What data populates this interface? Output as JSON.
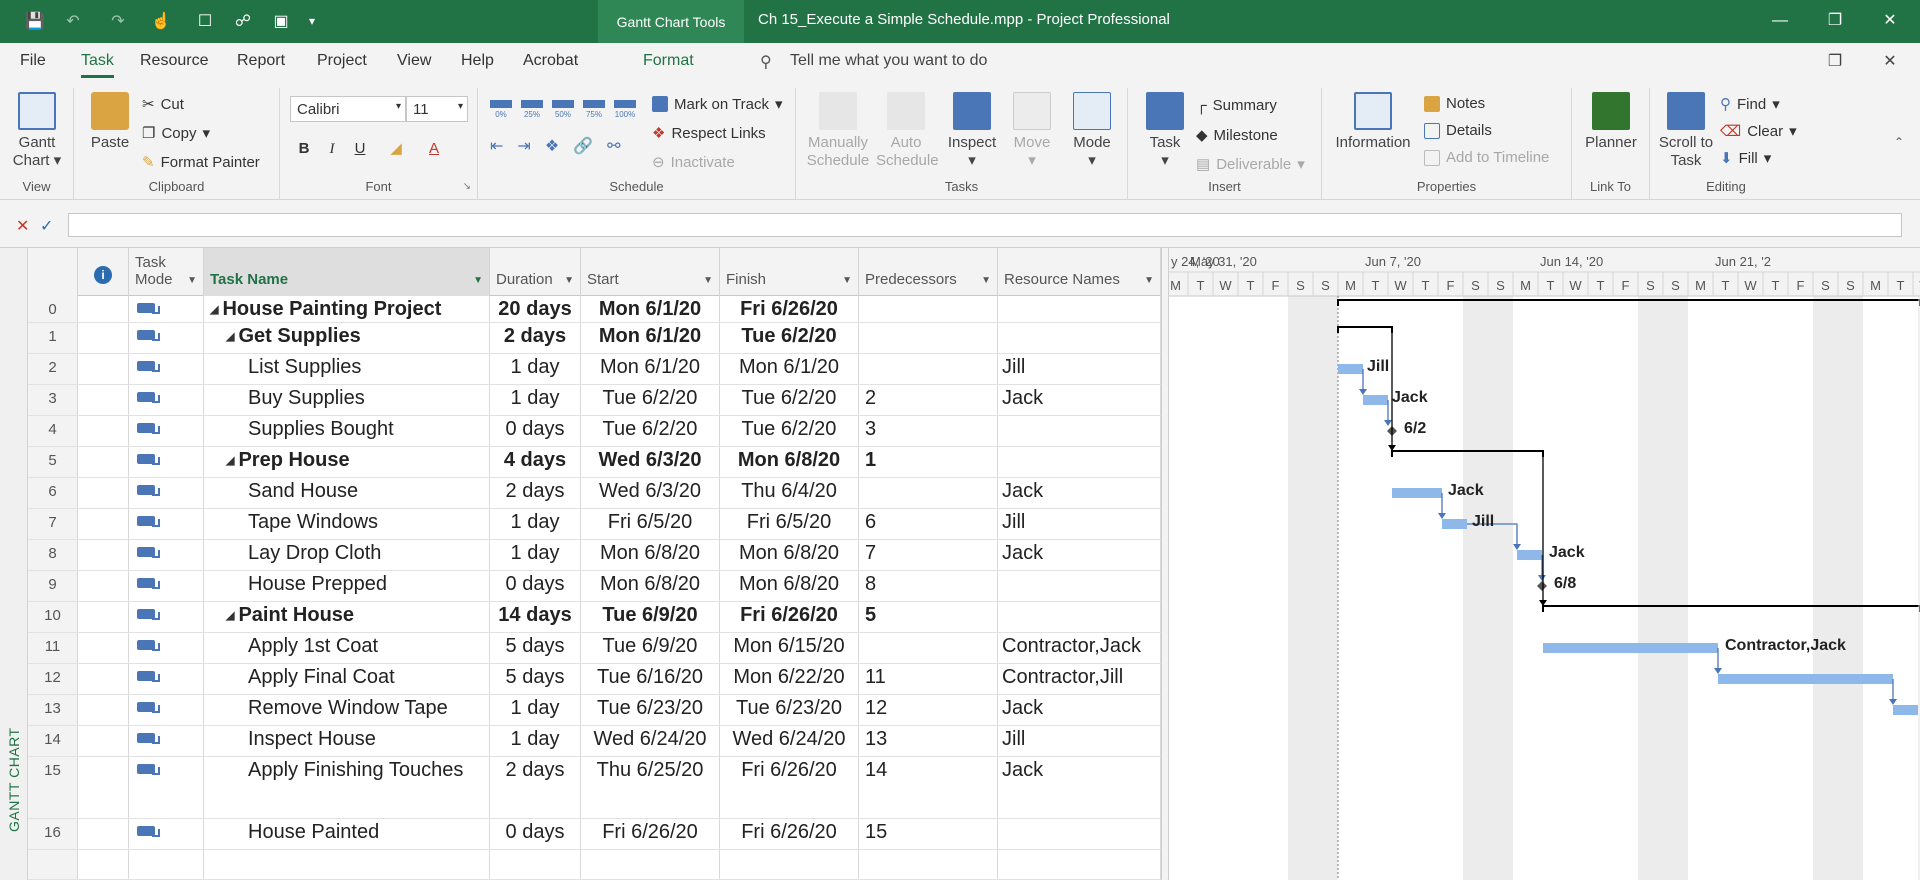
{
  "window": {
    "title": "Ch 15_Execute a Simple Schedule.mpp  -  Project Professional",
    "context_tab_group": "Gantt Chart Tools"
  },
  "menu": {
    "tabs": [
      "File",
      "Task",
      "Resource",
      "Report",
      "Project",
      "View",
      "Help",
      "Acrobat"
    ],
    "context_tab": "Format",
    "tell_me": "Tell me what you want to do"
  },
  "ribbon": {
    "view": {
      "label": "View",
      "gantt": "Gantt Chart"
    },
    "clipboard": {
      "label": "Clipboard",
      "paste": "Paste",
      "cut": "Cut",
      "copy": "Copy",
      "format_painter": "Format Painter"
    },
    "font": {
      "label": "Font",
      "family": "Calibri",
      "size": "11",
      "bold": "B",
      "italic": "I",
      "underline": "U"
    },
    "schedule": {
      "label": "Schedule",
      "mark_on_track": "Mark on Track",
      "respect_links": "Respect Links",
      "inactivate": "Inactivate",
      "pct": [
        "0%",
        "25%",
        "50%",
        "75%",
        "100%"
      ]
    },
    "tasks": {
      "label": "Tasks",
      "manually": "Manually Schedule",
      "auto": "Auto Schedule",
      "inspect": "Inspect",
      "move": "Move",
      "mode": "Mode"
    },
    "insert": {
      "label": "Insert",
      "task": "Task",
      "summary": "Summary",
      "milestone": "Milestone",
      "deliverable": "Deliverable"
    },
    "properties": {
      "label": "Properties",
      "information": "Information",
      "notes": "Notes",
      "details": "Details",
      "add_timeline": "Add to Timeline"
    },
    "linkto": {
      "label": "Link To",
      "planner": "Planner"
    },
    "editing": {
      "label": "Editing",
      "scroll": "Scroll to Task",
      "find": "Find",
      "clear": "Clear",
      "fill": "Fill"
    }
  },
  "side_label": "GANTT CHART",
  "columns": {
    "task_mode": "Task Mode",
    "task_name": "Task Name",
    "duration": "Duration",
    "start": "Start",
    "finish": "Finish",
    "predecessors": "Predecessors",
    "resource_names": "Resource Names"
  },
  "tasks": [
    {
      "id": "0",
      "name": "House Painting Project",
      "duration": "20 days",
      "start": "Mon 6/1/20",
      "finish": "Fri 6/26/20",
      "pred": "",
      "res": "",
      "level": 0,
      "summary": true
    },
    {
      "id": "1",
      "name": "Get Supplies",
      "duration": "2 days",
      "start": "Mon 6/1/20",
      "finish": "Tue 6/2/20",
      "pred": "",
      "res": "",
      "level": 1,
      "summary": true
    },
    {
      "id": "2",
      "name": "List Supplies",
      "duration": "1 day",
      "start": "Mon 6/1/20",
      "finish": "Mon 6/1/20",
      "pred": "",
      "res": "Jill",
      "level": 2,
      "summary": false
    },
    {
      "id": "3",
      "name": "Buy Supplies",
      "duration": "1 day",
      "start": "Tue 6/2/20",
      "finish": "Tue 6/2/20",
      "pred": "2",
      "res": "Jack",
      "level": 2,
      "summary": false
    },
    {
      "id": "4",
      "name": "Supplies Bought",
      "duration": "0 days",
      "start": "Tue 6/2/20",
      "finish": "Tue 6/2/20",
      "pred": "3",
      "res": "",
      "level": 2,
      "summary": false
    },
    {
      "id": "5",
      "name": "Prep House",
      "duration": "4 days",
      "start": "Wed 6/3/20",
      "finish": "Mon 6/8/20",
      "pred": "1",
      "res": "",
      "level": 1,
      "summary": true
    },
    {
      "id": "6",
      "name": "Sand House",
      "duration": "2 days",
      "start": "Wed 6/3/20",
      "finish": "Thu 6/4/20",
      "pred": "",
      "res": "Jack",
      "level": 2,
      "summary": false
    },
    {
      "id": "7",
      "name": "Tape Windows",
      "duration": "1 day",
      "start": "Fri 6/5/20",
      "finish": "Fri 6/5/20",
      "pred": "6",
      "res": "Jill",
      "level": 2,
      "summary": false
    },
    {
      "id": "8",
      "name": "Lay Drop Cloth",
      "duration": "1 day",
      "start": "Mon 6/8/20",
      "finish": "Mon 6/8/20",
      "pred": "7",
      "res": "Jack",
      "level": 2,
      "summary": false
    },
    {
      "id": "9",
      "name": "House Prepped",
      "duration": "0 days",
      "start": "Mon 6/8/20",
      "finish": "Mon 6/8/20",
      "pred": "8",
      "res": "",
      "level": 2,
      "summary": false
    },
    {
      "id": "10",
      "name": "Paint House",
      "duration": "14 days",
      "start": "Tue 6/9/20",
      "finish": "Fri 6/26/20",
      "pred": "5",
      "res": "",
      "level": 1,
      "summary": true
    },
    {
      "id": "11",
      "name": "Apply 1st Coat",
      "duration": "5 days",
      "start": "Tue 6/9/20",
      "finish": "Mon 6/15/20",
      "pred": "",
      "res": "Contractor,Jack",
      "level": 2,
      "summary": false
    },
    {
      "id": "12",
      "name": "Apply Final Coat",
      "duration": "5 days",
      "start": "Tue 6/16/20",
      "finish": "Mon 6/22/20",
      "pred": "11",
      "res": "Contractor,Jill",
      "level": 2,
      "summary": false
    },
    {
      "id": "13",
      "name": "Remove Window Tape",
      "duration": "1 day",
      "start": "Tue 6/23/20",
      "finish": "Tue 6/23/20",
      "pred": "12",
      "res": "Jack",
      "level": 2,
      "summary": false
    },
    {
      "id": "14",
      "name": "Inspect House",
      "duration": "1 day",
      "start": "Wed 6/24/20",
      "finish": "Wed 6/24/20",
      "pred": "13",
      "res": "Jill",
      "level": 2,
      "summary": false
    },
    {
      "id": "15",
      "name": "Apply Finishing Touches",
      "duration": "2 days",
      "start": "Thu 6/25/20",
      "finish": "Fri 6/26/20",
      "pred": "14",
      "res": "Jack",
      "level": 2,
      "summary": false
    },
    {
      "id": "16",
      "name": "House Painted",
      "duration": "0 days",
      "start": "Fri 6/26/20",
      "finish": "Fri 6/26/20",
      "pred": "15",
      "res": "",
      "level": 2,
      "summary": false
    }
  ],
  "timescale": {
    "weeks": [
      "y 24, '20",
      "May 31, '20",
      "Jun 7, '20",
      "Jun 14, '20",
      "Jun 21, '2"
    ],
    "days": [
      "M",
      "T",
      "W",
      "T",
      "F",
      "S",
      "S",
      "M",
      "T",
      "W",
      "T",
      "F",
      "S",
      "S",
      "M",
      "T",
      "W",
      "T",
      "F",
      "S",
      "S",
      "M",
      "T",
      "W",
      "T",
      "F",
      "S",
      "S",
      "M",
      "T",
      "W",
      "T",
      "F",
      "S",
      "S",
      "M"
    ]
  },
  "gantt_labels": {
    "t2": "Jill",
    "t3": "Jack",
    "t4": "6/2",
    "t6": "Jack",
    "t7": "Jill",
    "t8": "Jack",
    "t9": "6/8",
    "t11": "Contractor,Jack"
  },
  "colors": {
    "accent": "#217346",
    "bar": "#8fb8ea",
    "nonworking": "#ececec",
    "summary": "#000000"
  }
}
